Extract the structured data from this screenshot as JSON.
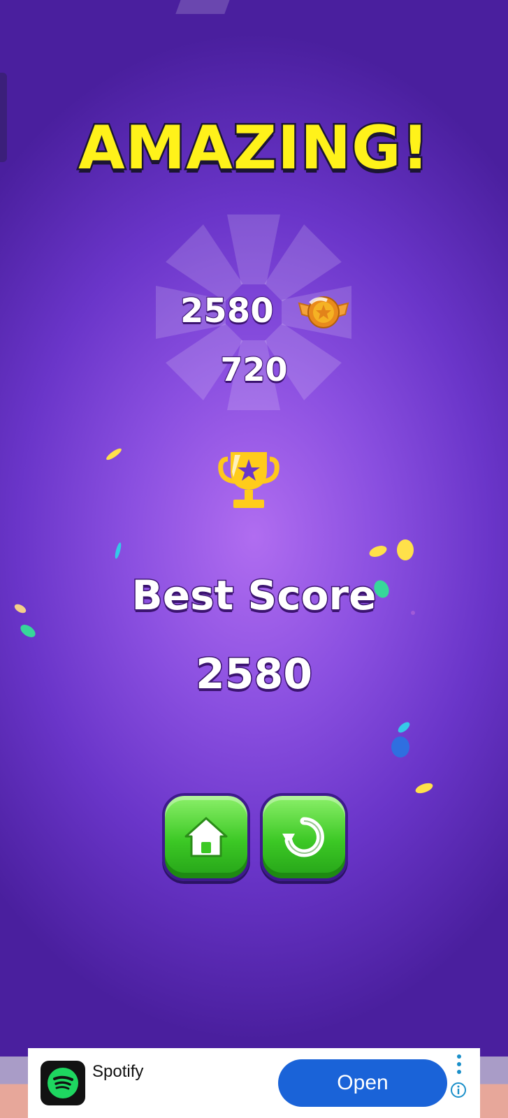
{
  "result": {
    "title": "AMAZING!",
    "score": "2580",
    "bonus": "720",
    "best_label": "Best Score",
    "best_value": "2580"
  },
  "icons": {
    "medal": "medal-icon",
    "trophy": "trophy-icon",
    "home": "home-icon",
    "replay": "replay-icon"
  },
  "ad": {
    "app_name": "Spotify",
    "cta_label": "Open"
  },
  "colors": {
    "title_yellow": "#fff21a",
    "button_green": "#3cc825",
    "ad_button_blue": "#1a63d8"
  }
}
